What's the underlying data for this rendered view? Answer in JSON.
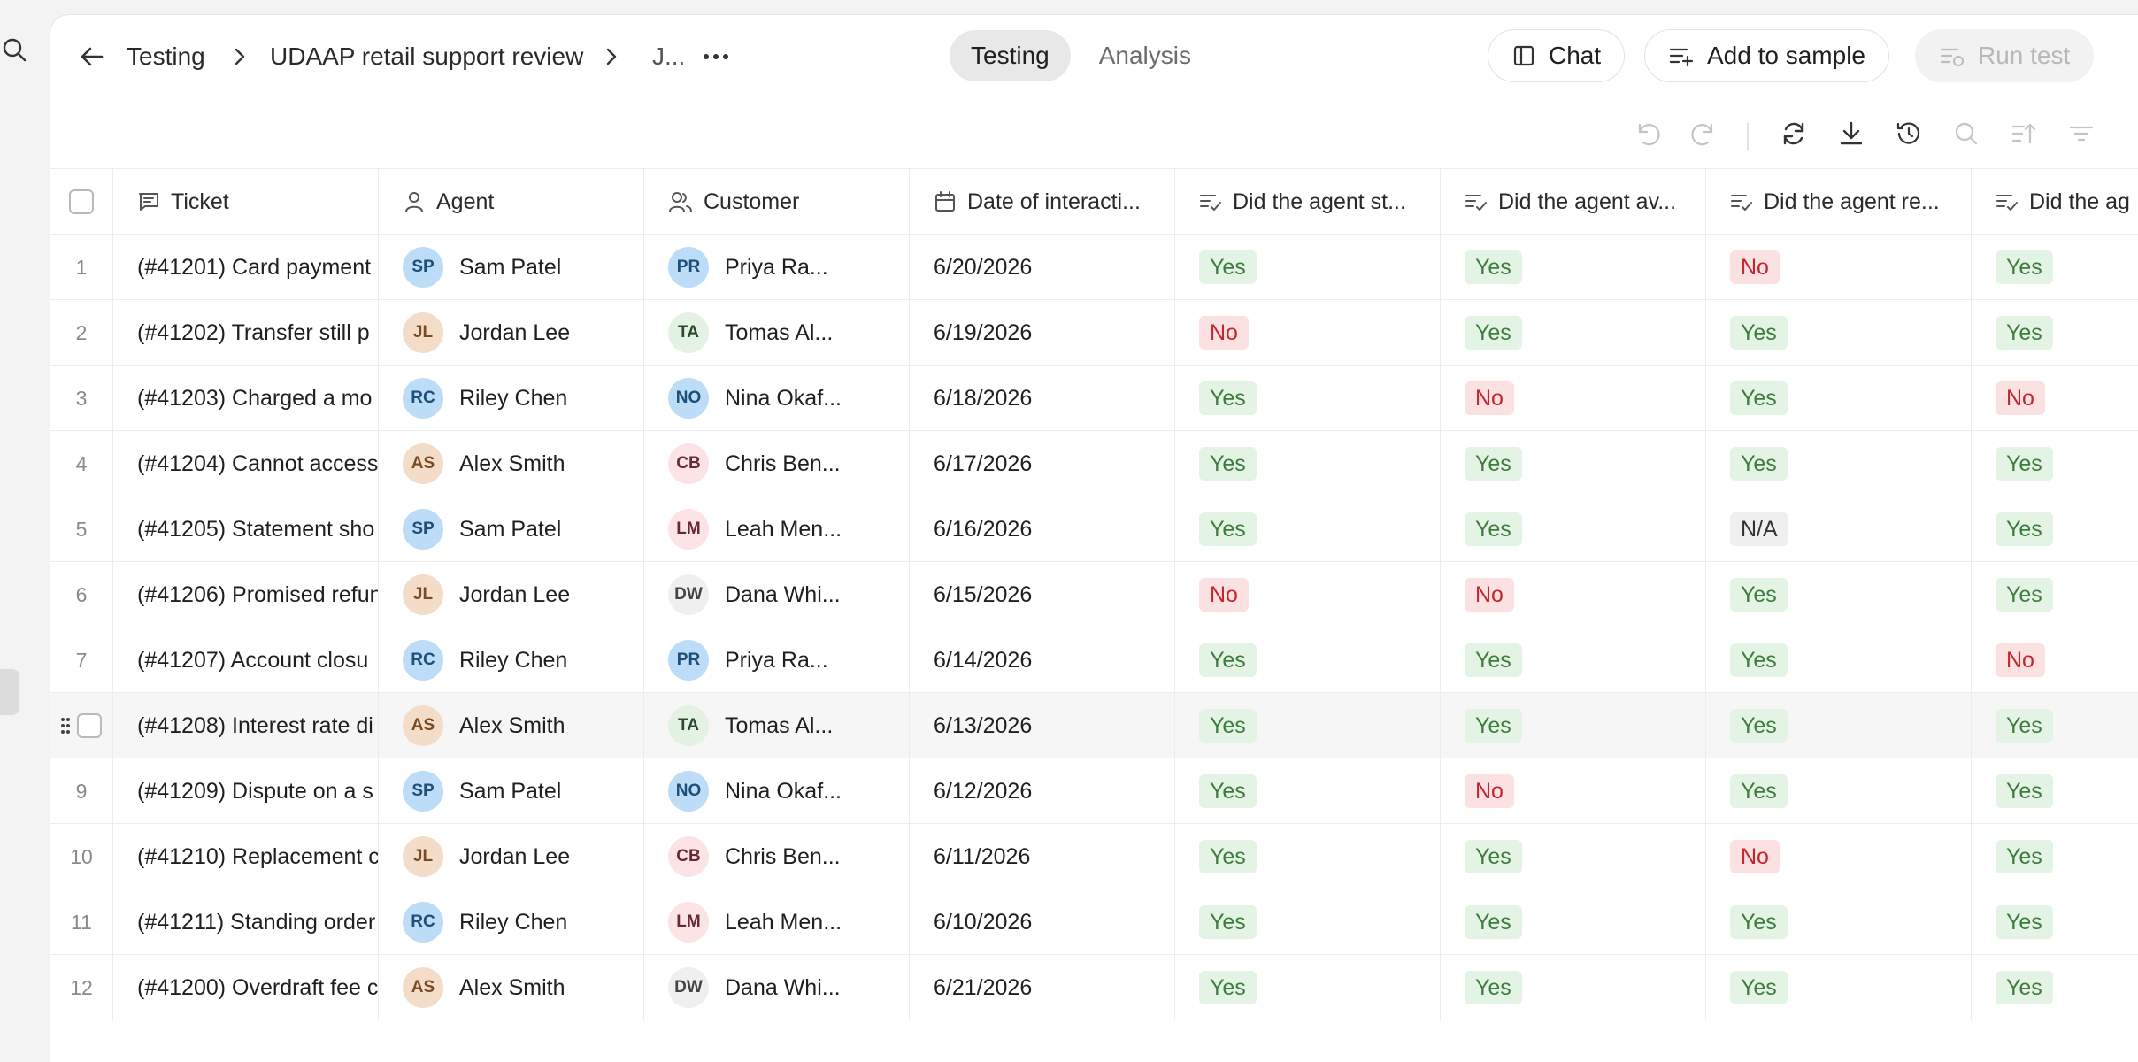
{
  "breadcrumb": {
    "items": [
      "Testing",
      "UDAAP retail support review",
      "J..."
    ]
  },
  "view_tabs": [
    {
      "label": "Testing",
      "active": true
    },
    {
      "label": "Analysis",
      "active": false
    }
  ],
  "actions": {
    "chat_label": "Chat",
    "add_to_sample_label": "Add to sample",
    "run_test_label": "Run test"
  },
  "toolbar_icons": [
    "undo-icon",
    "redo-icon",
    "refresh-icon",
    "download-icon",
    "history-icon",
    "search-icon",
    "sort-icon",
    "filter-icon"
  ],
  "columns": {
    "ticket": "Ticket",
    "agent": "Agent",
    "customer": "Customer",
    "date": "Date of interacti...",
    "q1": "Did the agent st...",
    "q2": "Did the agent av...",
    "q3": "Did the agent re...",
    "q4": "Did the ag"
  },
  "colors": {
    "yes_bg": "#e4f4e4",
    "yes_text": "#3e7d3e",
    "no_bg": "#fbe1e2",
    "no_text": "#c4262e",
    "na_bg": "#efefef"
  },
  "rows": [
    {
      "idx": "1",
      "ticket": "(#41201) Card payment",
      "agent": {
        "initials": "SP",
        "name": "Sam Patel",
        "color": "blue"
      },
      "customer": {
        "initials": "PR",
        "name": "Priya Ra...",
        "color": "blue"
      },
      "date": "6/20/2026",
      "answers": [
        "Yes",
        "Yes",
        "No",
        "Yes"
      ]
    },
    {
      "idx": "2",
      "ticket": "(#41202) Transfer still p",
      "agent": {
        "initials": "JL",
        "name": "Jordan Lee",
        "color": "tan"
      },
      "customer": {
        "initials": "TA",
        "name": "Tomas Al...",
        "color": "green"
      },
      "date": "6/19/2026",
      "answers": [
        "No",
        "Yes",
        "Yes",
        "Yes"
      ]
    },
    {
      "idx": "3",
      "ticket": "(#41203) Charged a mo",
      "agent": {
        "initials": "RC",
        "name": "Riley Chen",
        "color": "blue"
      },
      "customer": {
        "initials": "NO",
        "name": "Nina Okaf...",
        "color": "blue"
      },
      "date": "6/18/2026",
      "answers": [
        "Yes",
        "No",
        "Yes",
        "No"
      ]
    },
    {
      "idx": "4",
      "ticket": "(#41204) Cannot access",
      "agent": {
        "initials": "AS",
        "name": "Alex Smith",
        "color": "tan"
      },
      "customer": {
        "initials": "CB",
        "name": "Chris Ben...",
        "color": "pink"
      },
      "date": "6/17/2026",
      "answers": [
        "Yes",
        "Yes",
        "Yes",
        "Yes"
      ]
    },
    {
      "idx": "5",
      "ticket": "(#41205) Statement sho",
      "agent": {
        "initials": "SP",
        "name": "Sam Patel",
        "color": "blue"
      },
      "customer": {
        "initials": "LM",
        "name": "Leah Men...",
        "color": "pink"
      },
      "date": "6/16/2026",
      "answers": [
        "Yes",
        "Yes",
        "N/A",
        "Yes"
      ]
    },
    {
      "idx": "6",
      "ticket": "(#41206) Promised refun",
      "agent": {
        "initials": "JL",
        "name": "Jordan Lee",
        "color": "tan"
      },
      "customer": {
        "initials": "DW",
        "name": "Dana Whi...",
        "color": "gray"
      },
      "date": "6/15/2026",
      "answers": [
        "No",
        "No",
        "Yes",
        "Yes"
      ]
    },
    {
      "idx": "7",
      "ticket": "(#41207) Account closu",
      "agent": {
        "initials": "RC",
        "name": "Riley Chen",
        "color": "blue"
      },
      "customer": {
        "initials": "PR",
        "name": "Priya Ra...",
        "color": "blue"
      },
      "date": "6/14/2026",
      "answers": [
        "Yes",
        "Yes",
        "Yes",
        "No"
      ]
    },
    {
      "idx": "8",
      "ticket": "(#41208) Interest rate di",
      "agent": {
        "initials": "AS",
        "name": "Alex Smith",
        "color": "tan"
      },
      "customer": {
        "initials": "TA",
        "name": "Tomas Al...",
        "color": "green"
      },
      "date": "6/13/2026",
      "answers": [
        "Yes",
        "Yes",
        "Yes",
        "Yes"
      ],
      "hover": true
    },
    {
      "idx": "9",
      "ticket": "(#41209) Dispute on a s",
      "agent": {
        "initials": "SP",
        "name": "Sam Patel",
        "color": "blue"
      },
      "customer": {
        "initials": "NO",
        "name": "Nina Okaf...",
        "color": "blue"
      },
      "date": "6/12/2026",
      "answers": [
        "Yes",
        "No",
        "Yes",
        "Yes"
      ]
    },
    {
      "idx": "10",
      "ticket": "(#41210) Replacement c",
      "agent": {
        "initials": "JL",
        "name": "Jordan Lee",
        "color": "tan"
      },
      "customer": {
        "initials": "CB",
        "name": "Chris Ben...",
        "color": "pink"
      },
      "date": "6/11/2026",
      "answers": [
        "Yes",
        "Yes",
        "No",
        "Yes"
      ]
    },
    {
      "idx": "11",
      "ticket": "(#41211) Standing order",
      "agent": {
        "initials": "RC",
        "name": "Riley Chen",
        "color": "blue"
      },
      "customer": {
        "initials": "LM",
        "name": "Leah Men...",
        "color": "pink"
      },
      "date": "6/10/2026",
      "answers": [
        "Yes",
        "Yes",
        "Yes",
        "Yes"
      ]
    },
    {
      "idx": "12",
      "ticket": "(#41200) Overdraft fee c",
      "agent": {
        "initials": "AS",
        "name": "Alex Smith",
        "color": "tan"
      },
      "customer": {
        "initials": "DW",
        "name": "Dana Whi...",
        "color": "gray"
      },
      "date": "6/21/2026",
      "answers": [
        "Yes",
        "Yes",
        "Yes",
        "Yes"
      ]
    }
  ]
}
